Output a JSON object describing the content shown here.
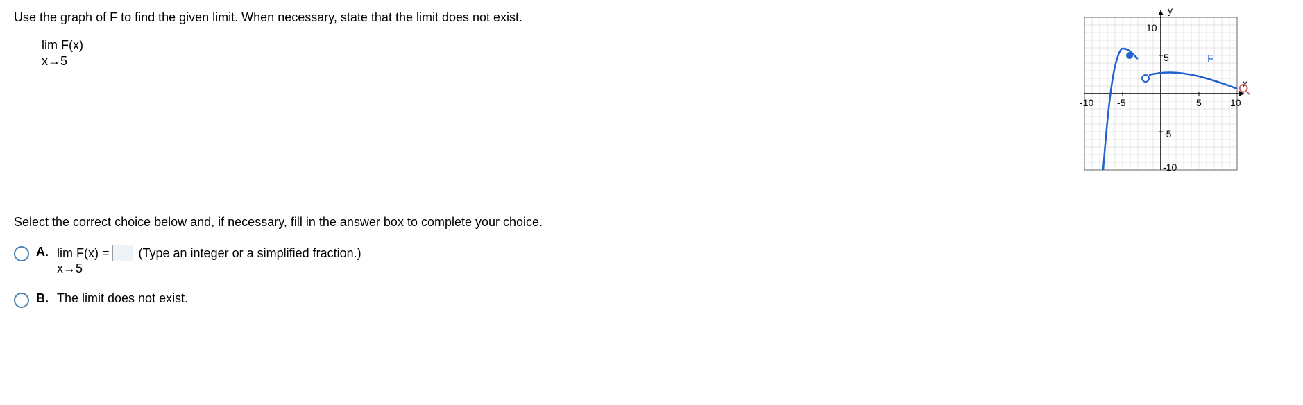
{
  "question": {
    "prompt": "Use the graph of F to find the given limit. When necessary, state that the limit does not exist.",
    "limit_top": "lim F(x)",
    "limit_bottom": "x→5"
  },
  "graph": {
    "y_label": "y",
    "x_label": "x",
    "ticks": {
      "neg10": "-10",
      "neg5": "-5",
      "pos5": "5",
      "pos10": "10"
    },
    "tick10": "10",
    "curve_label": "F"
  },
  "answer_section": {
    "instruction": "Select the correct choice below and, if necessary, fill in the answer box to complete your choice.",
    "choiceA": {
      "letter": "A.",
      "limit_top": "lim F(x) =",
      "limit_bottom": "x→5",
      "hint": "(Type an integer or a simplified fraction.)"
    },
    "choiceB": {
      "letter": "B.",
      "text": "The limit does not exist."
    }
  }
}
